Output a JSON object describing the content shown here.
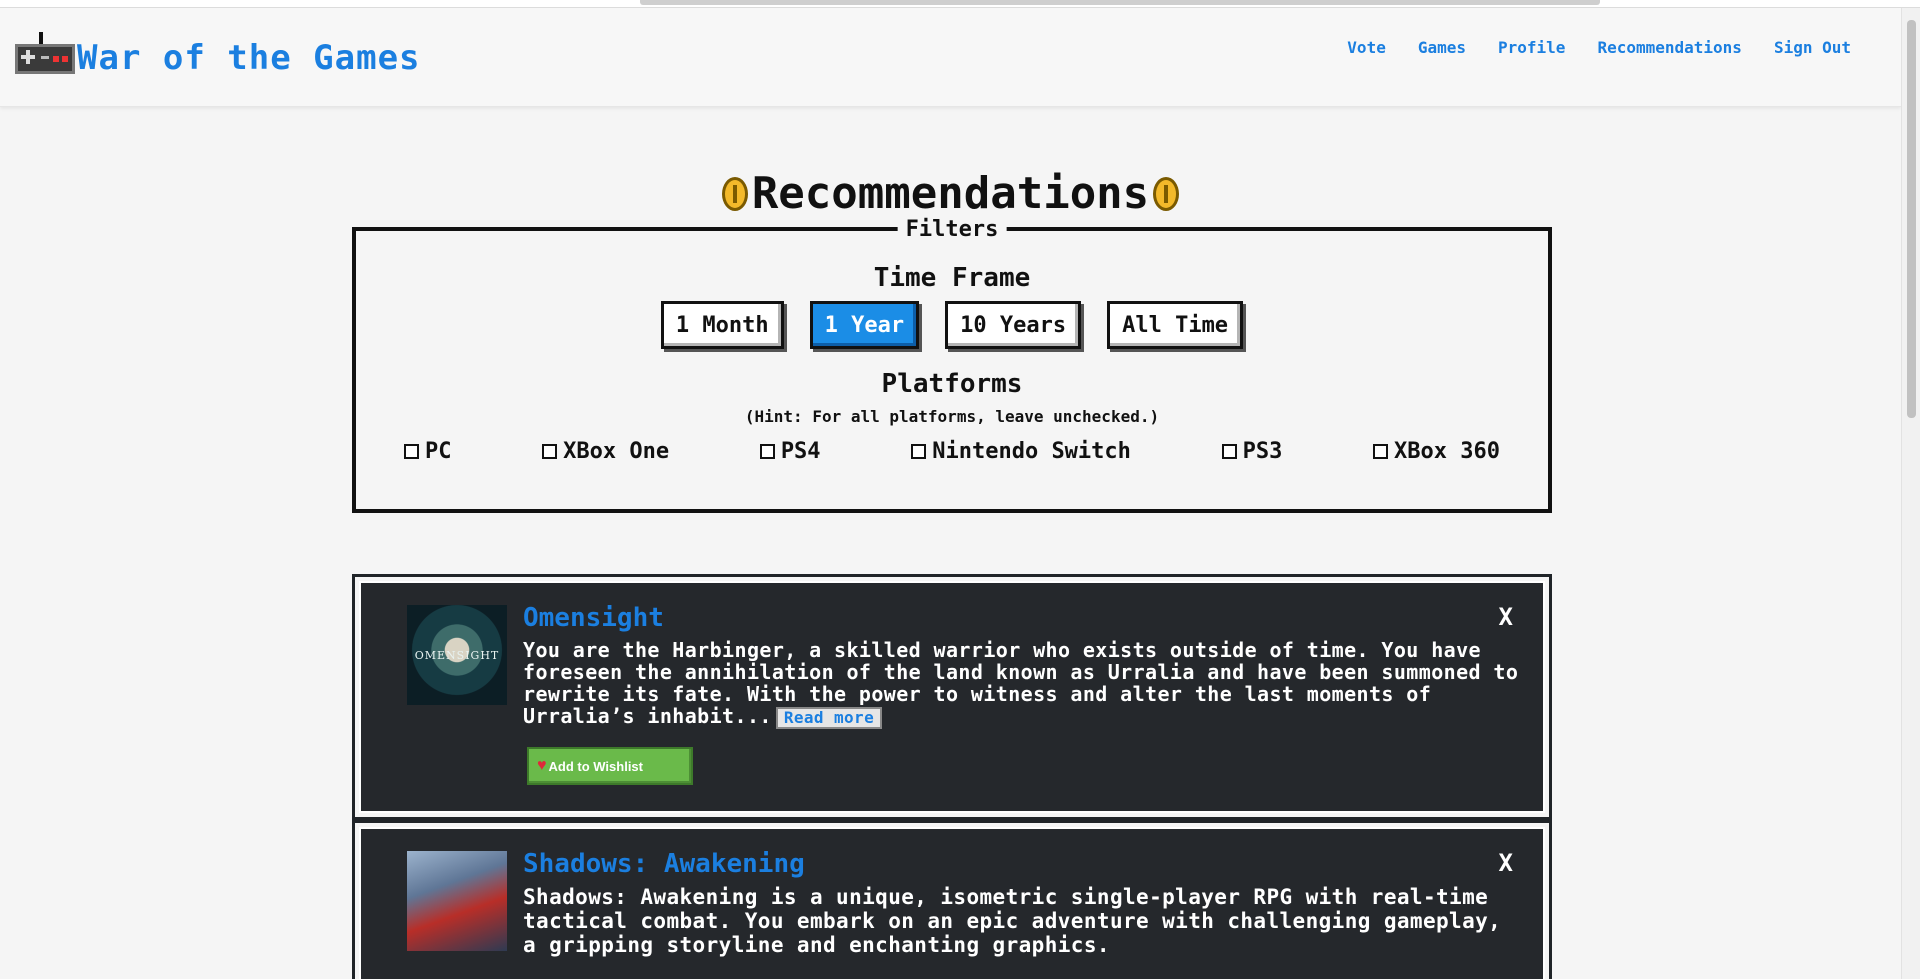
{
  "app": {
    "title": "War of the Games",
    "nav": [
      "Vote",
      "Games",
      "Profile",
      "Recommendations",
      "Sign Out"
    ]
  },
  "page": {
    "title": "Recommendations"
  },
  "filters": {
    "legend": "Filters",
    "time_frame_title": "Time Frame",
    "time_frames": [
      "1 Month",
      "1 Year",
      "10 Years",
      "All Time"
    ],
    "selected_time_frame": "1 Year",
    "platforms_title": "Platforms",
    "platforms_hint": "(Hint: For all platforms, leave unchecked.)",
    "platforms": [
      "PC",
      "XBox One",
      "PS4",
      "Nintendo Switch",
      "PS3",
      "XBox 360"
    ]
  },
  "games": [
    {
      "title": "Omensight",
      "cover_text": "OMENSIGHT",
      "description": "You are the Harbinger, a skilled warrior who exists outside of time. You have foreseen the annihilation of the land known as Urralia and have been summoned to rewrite its fate. With the power to witness and alter the last moments of Urralia’s inhabit...",
      "read_more": "Read more",
      "wishlist": "Add to Wishlist",
      "close": "X"
    },
    {
      "title": "Shadows: Awakening",
      "description": "Shadows: Awakening is a unique, isometric single-player RPG with real-time tactical combat. You embark on an epic adventure with challenging gameplay, a gripping storyline and enchanting graphics.",
      "close": "X"
    }
  ],
  "colors": {
    "accent": "#1b7fe0",
    "active_button": "#1b8de6",
    "card_bg": "#25282c",
    "wishlist_green": "#6aba4a",
    "coin": "#f3b92a"
  },
  "icons": {
    "logo": "game-controller-icon",
    "title_decoration": "coin-icon",
    "wishlist": "heart-icon",
    "close": "close-icon"
  }
}
